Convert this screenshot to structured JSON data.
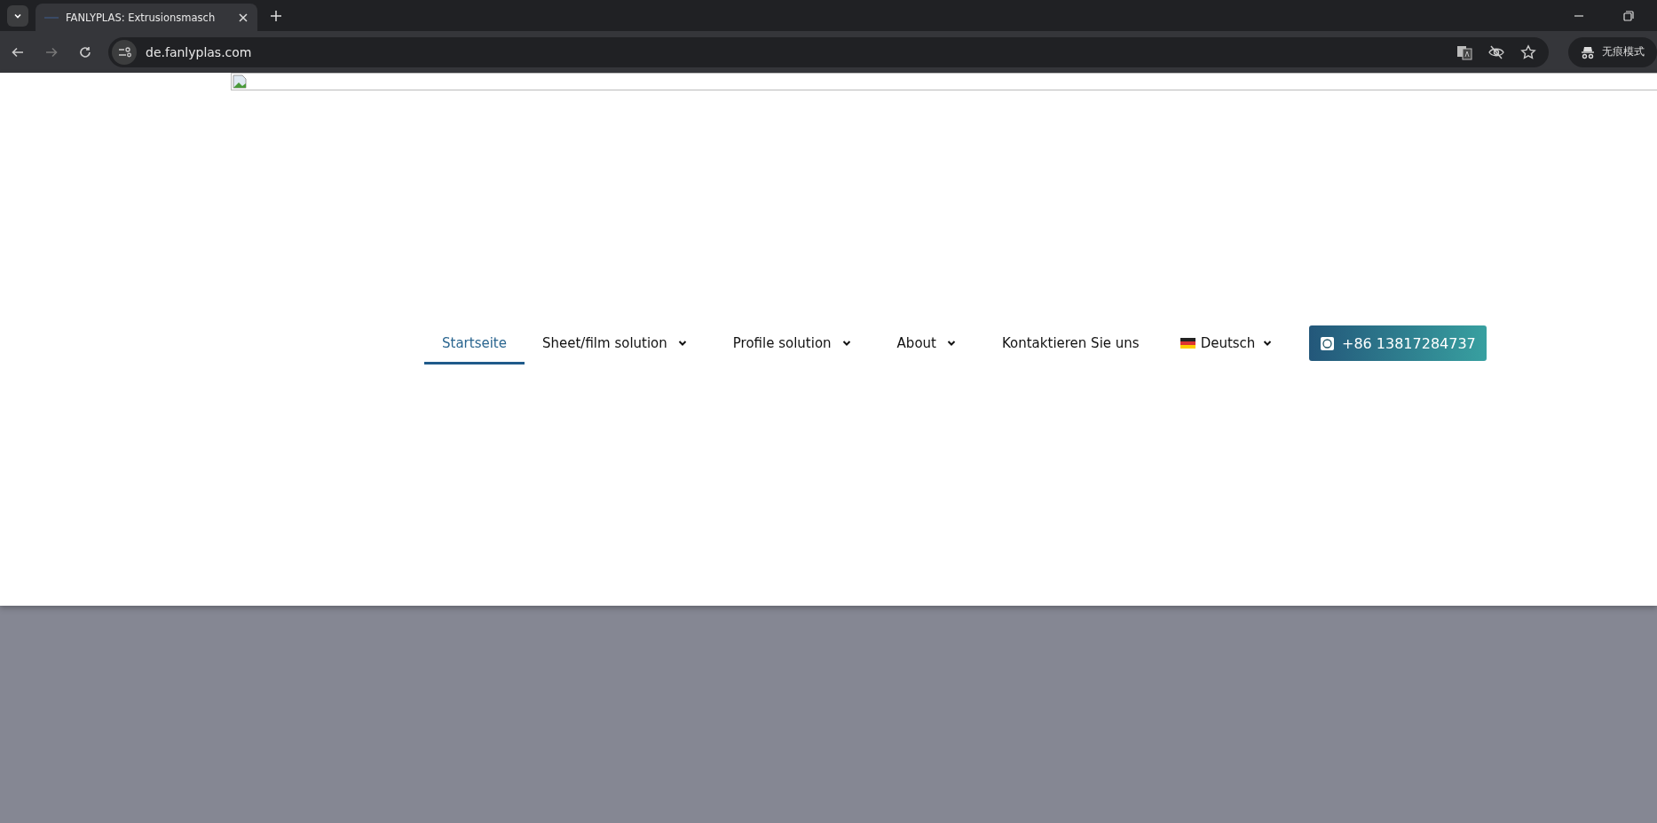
{
  "browser": {
    "tab": {
      "title": "FANLYPLAS: Extrusionsmasch",
      "selected": true
    },
    "url": "de.fanlyplas.com",
    "profile": "无痕模式"
  },
  "nav": [
    {
      "label": "Startseite",
      "kind": "link",
      "selected": true
    },
    {
      "label": "Sheet/film solution",
      "kind": "dropdown",
      "selected": false
    },
    {
      "label": "Profile solution",
      "kind": "dropdown",
      "selected": false
    },
    {
      "label": "About",
      "kind": "dropdown",
      "selected": false
    },
    {
      "label": "Kontaktieren Sie uns",
      "kind": "link",
      "selected": false
    },
    {
      "label": "Deutsch",
      "kind": "language",
      "selected": false
    }
  ],
  "phone_button": {
    "label": "+86 13817284737"
  }
}
